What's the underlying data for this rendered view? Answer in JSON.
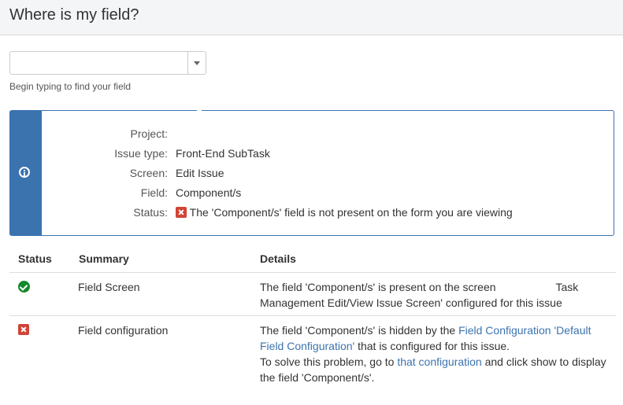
{
  "header": {
    "title": "Where is my field?"
  },
  "field_search": {
    "value": "",
    "helper": "Begin typing to find your field"
  },
  "info_panel": {
    "rows": [
      {
        "label": "Project:",
        "value": ""
      },
      {
        "label": "Issue type:",
        "value": "Front-End SubTask"
      },
      {
        "label": "Screen:",
        "value": "Edit Issue"
      },
      {
        "label": "Field:",
        "value": "Component/s"
      },
      {
        "label": "Status:",
        "value": "The 'Component/s' field is not present on the form you are viewing"
      }
    ],
    "status_icon": "error-icon",
    "accent_color": "#3b73af"
  },
  "table": {
    "headers": {
      "status": "Status",
      "summary": "Summary",
      "details": "Details"
    },
    "rows": [
      {
        "status": "ok",
        "status_icon": "check-circle-icon",
        "summary": "Field Screen",
        "details": {
          "part1": "The field 'Component/s' is present on the screen",
          "part2": "Task",
          "line2": "Management Edit/View Issue Screen' configured for this issue"
        }
      },
      {
        "status": "error",
        "status_icon": "error-icon",
        "summary": "Field configuration",
        "details": {
          "line1_text": "The field 'Component/s' is hidden by the ",
          "line1_link": "Field Configuration 'Default",
          "line2_link": "Field Configuration'",
          "line2_text": " that is configured for this issue.",
          "line3_text": "To solve this problem, go to ",
          "line3_link": "that configuration",
          "line3_rest": " and click show to display",
          "line4_text": "the field 'Component/s'."
        }
      }
    ]
  },
  "colors": {
    "ok": "#14892c",
    "error": "#d04437",
    "link": "#3b73af"
  }
}
